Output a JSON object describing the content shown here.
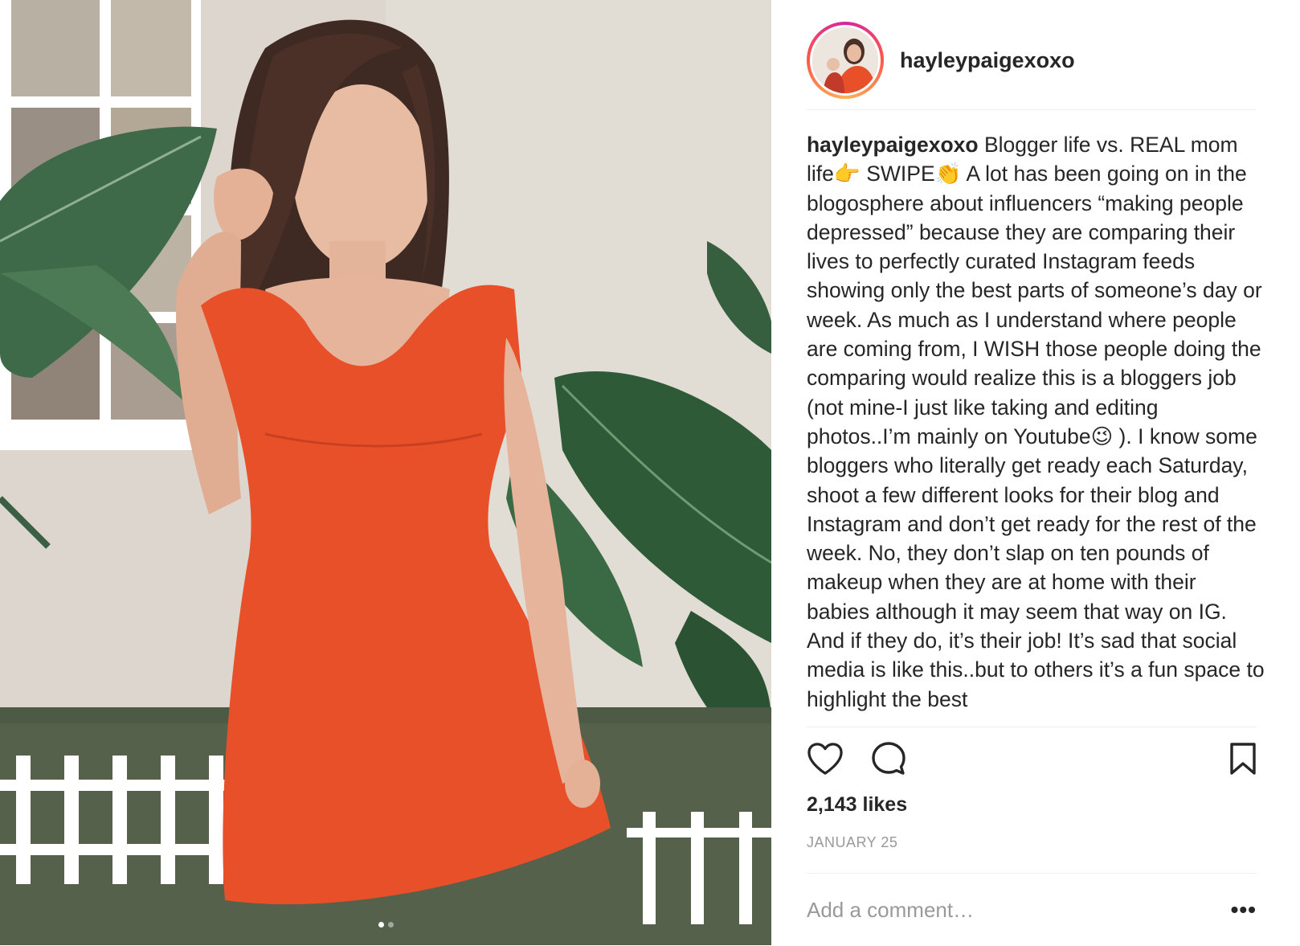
{
  "post": {
    "username": "hayleypaigexoxo",
    "caption_text": " Blogger life vs. REAL mom life👉 SWIPE👏 A lot has been going on in the blogosphere about influencers “making people depressed” because they are comparing their lives to perfectly curated Instagram feeds showing only the best parts of someone’s day or week. As much as I understand where people are coming from, I WISH those people doing the comparing would realize this is a bloggers job (not mine-I just like taking and editing photos..I’m mainly on Youtube😉 ). I know some bloggers who literally get ready each Saturday, shoot a few different looks for their blog and Instagram and don’t get ready for the rest of the week. No, they don’t slap on ten pounds of makeup when they are at home with their babies although it may seem that way on IG. And if they do, it’s their job! It’s sad that social media is like this..but to others it’s a fun space to highlight the best",
    "likes": "2,143 likes",
    "date": "JANUARY 25",
    "carousel": {
      "count": 2,
      "active": 0
    }
  },
  "comment": {
    "placeholder": "Add a comment…"
  },
  "icons": {
    "like": "heart-icon",
    "comment": "comment-icon",
    "save": "bookmark-icon",
    "more": "more-options-icon"
  },
  "more_label": "•••",
  "colors": {
    "text": "#262626",
    "muted": "#999999",
    "divider": "#efefef",
    "dress": "#e8502a"
  }
}
